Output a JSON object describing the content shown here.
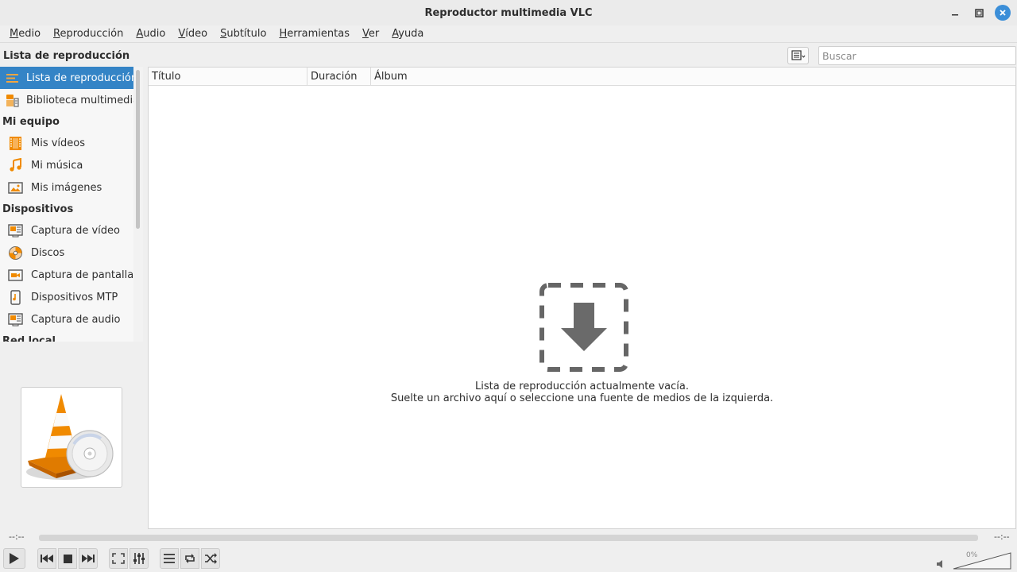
{
  "window": {
    "title": "Reproductor multimedia VLC",
    "controls": [
      "minimize-icon",
      "maximize-icon",
      "close-icon"
    ]
  },
  "menu": [
    {
      "label": "Medio",
      "accel": "M",
      "rest": "edio"
    },
    {
      "label": "Reproducción",
      "accel": "R",
      "rest": "eproducción"
    },
    {
      "label": "Audio",
      "accel": "A",
      "rest": "udio"
    },
    {
      "label": "Vídeo",
      "accel": "V",
      "rest": "ídeo"
    },
    {
      "label": "Subtítulo",
      "accel": "S",
      "rest": "ubtítulo"
    },
    {
      "label": "Herramientas",
      "accel": "H",
      "rest": "erramientas"
    },
    {
      "label": "Ver",
      "accel": "V",
      "rest": "er"
    },
    {
      "label": "Ayuda",
      "accel": "A",
      "rest": "yuda"
    }
  ],
  "playlist_header": {
    "title": "Lista de reproducción",
    "search_placeholder": "Buscar"
  },
  "sidebar": {
    "top_items": [
      {
        "label": "Lista de reproducción",
        "icon": "playlist-icon",
        "active": true
      },
      {
        "label": "Biblioteca multimedia",
        "icon": "media-library-icon",
        "active": false
      }
    ],
    "sections": [
      {
        "title": "Mi equipo",
        "items": [
          {
            "label": "Mis vídeos",
            "icon": "film-icon"
          },
          {
            "label": "Mi música",
            "icon": "music-note-icon"
          },
          {
            "label": "Mis imágenes",
            "icon": "image-icon"
          }
        ]
      },
      {
        "title": "Dispositivos",
        "items": [
          {
            "label": "Captura de vídeo",
            "icon": "capture-device-icon"
          },
          {
            "label": "Discos",
            "icon": "disc-icon"
          },
          {
            "label": "Captura de pantalla",
            "icon": "screen-capture-icon"
          },
          {
            "label": "Dispositivos MTP",
            "icon": "mtp-device-icon"
          },
          {
            "label": "Captura de audio",
            "icon": "audio-capture-icon"
          }
        ]
      },
      {
        "title": "Red local",
        "items": []
      }
    ]
  },
  "table": {
    "columns": [
      "Título",
      "Duración",
      "Álbum"
    ]
  },
  "empty_state": {
    "line1": "Lista de reproducción actualmente vacía.",
    "line2": "Suelte un archivo aquí o seleccione una fuente de medios de la izquierda."
  },
  "playback": {
    "elapsed": "--:--",
    "remaining": "--:--",
    "volume": "0%"
  },
  "colors": {
    "accent": "#3484c6",
    "orange": "#f08a00",
    "close_button": "#3b8ed8"
  }
}
